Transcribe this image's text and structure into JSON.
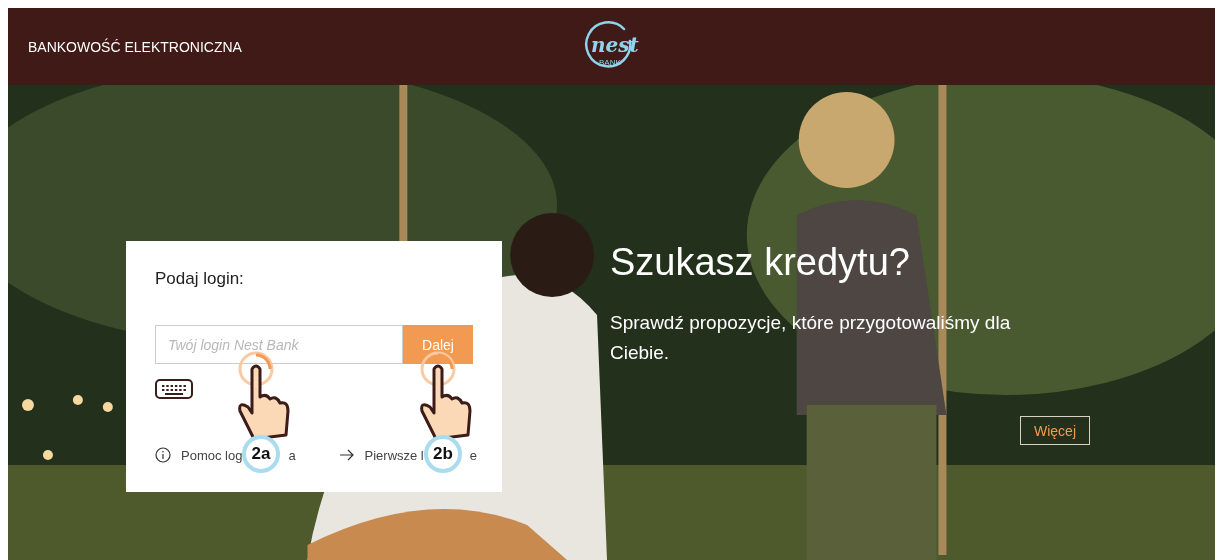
{
  "header": {
    "title": "BANKOWOŚĆ ELEKTRONICZNA",
    "logo": {
      "wordmark": "nest",
      "subtitle": "BANK"
    }
  },
  "hero": {
    "kind": "picture",
    "headline": "Szukasz kredytu?",
    "text": "Sprawdź propozycje, które przygotowaliśmy dla Ciebie.",
    "button": "Więcej"
  },
  "login": {
    "title": "Podaj login:",
    "field": {
      "placeholder": "Twój login Nest Bank"
    },
    "submit": "Dalej",
    "links": [
      {
        "kind": "help",
        "label_parts": [
          "Pomoc log",
          "a"
        ]
      },
      {
        "kind": "arrow",
        "label_parts": [
          "Pierwsze l",
          "e"
        ]
      }
    ]
  },
  "annotations": [
    {
      "label": "2a"
    },
    {
      "label": "2b"
    }
  ]
}
